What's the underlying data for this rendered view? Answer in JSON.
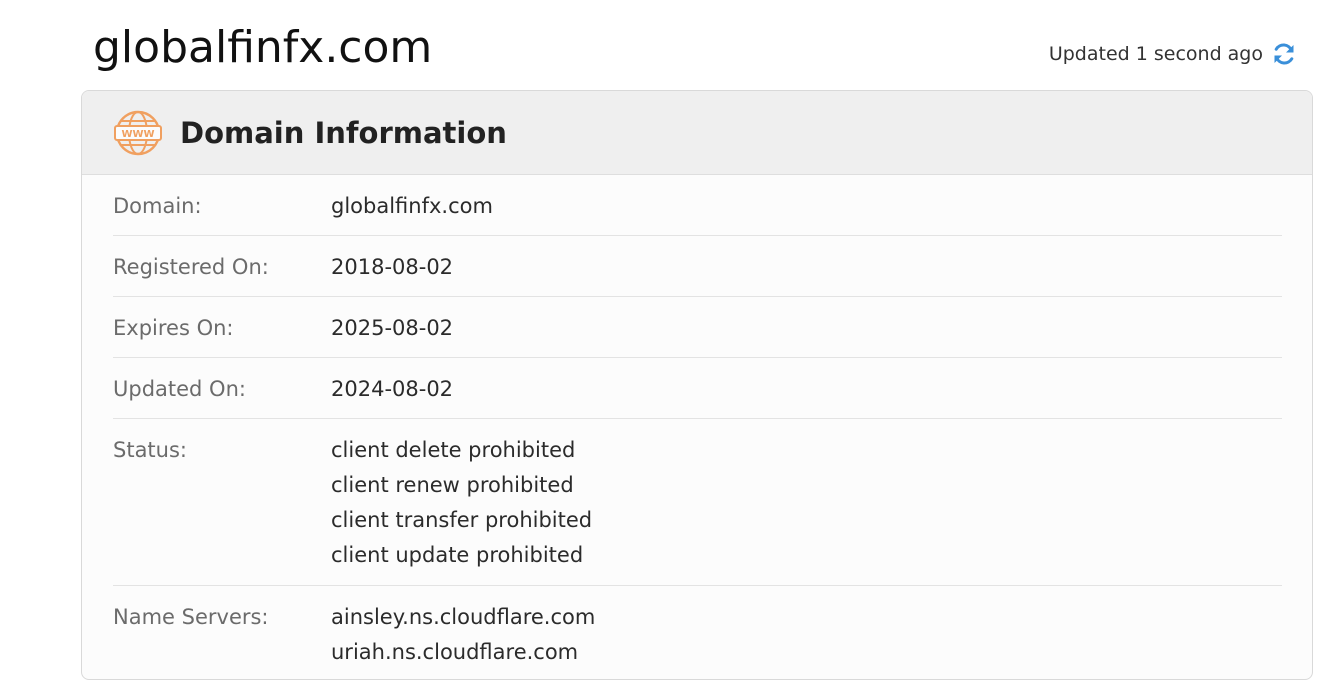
{
  "header": {
    "title": "globalfinfx.com",
    "updated_text": "Updated 1 second ago",
    "refresh_icon": "refresh-icon",
    "accent_color": "#3a8fd9"
  },
  "card": {
    "title": "Domain Information",
    "icon": "www-icon",
    "icon_color": "#f0a060",
    "rows": [
      {
        "label": "Domain:",
        "value": "globalfinfx.com"
      },
      {
        "label": "Registered On:",
        "value": "2018-08-02"
      },
      {
        "label": "Expires On:",
        "value": "2025-08-02"
      },
      {
        "label": "Updated On:",
        "value": "2024-08-02"
      },
      {
        "label": "Status:",
        "values": [
          "client delete prohibited",
          "client renew prohibited",
          "client transfer prohibited",
          "client update prohibited"
        ]
      },
      {
        "label": "Name Servers:",
        "values": [
          "ainsley.ns.cloudflare.com",
          "uriah.ns.cloudflare.com"
        ]
      }
    ]
  }
}
